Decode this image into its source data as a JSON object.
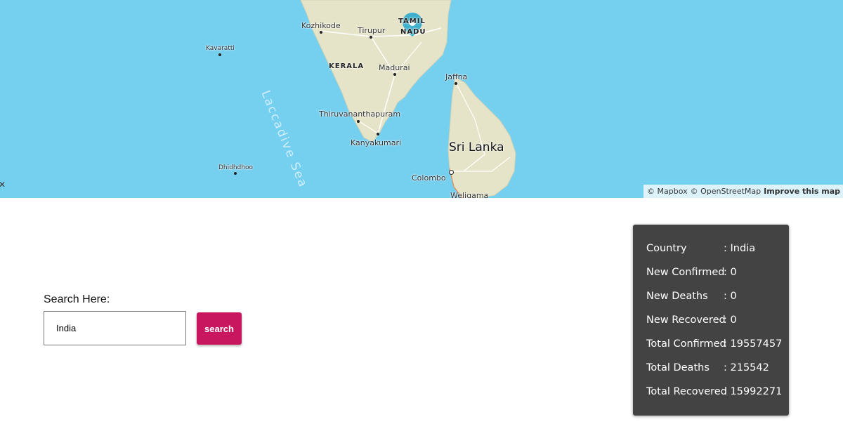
{
  "map": {
    "labels": {
      "kozhikode": "Kozhikode",
      "tirupur": "Tirupur",
      "kavaratti": "Kavaratti",
      "kerala": "KERALA",
      "madurai": "Madurai",
      "jaffna": "Jaffna",
      "thiruvananthapuram": "Thiruvananthapuram",
      "kanyakumari": "Kanyakumari",
      "sri_lanka": "Sri Lanka",
      "dhidhdhoo": "Dhidhdhoo",
      "colombo": "Colombo",
      "weligama": "Weligama",
      "tamil_nadu_1": "TAMIL",
      "tamil_nadu_2": "NADU",
      "laccadive_sea": "Laccadive Sea"
    },
    "attribution": {
      "mapbox": "© Mapbox",
      "osm": "© OpenStreetMap",
      "improve": "Improve this map"
    },
    "colors": {
      "water": "#75cfef",
      "land": "#e6e4c8",
      "marker": "#3fb1ce"
    }
  },
  "search": {
    "label": "Search Here:",
    "value": "India",
    "button_label": "search",
    "button_color": "#c8175f"
  },
  "stats": {
    "background": "#434343",
    "rows": [
      {
        "key": "Country",
        "value": ": India"
      },
      {
        "key": "New Confirmed",
        "value": ": 0"
      },
      {
        "key": "New Deaths",
        "value": ": 0"
      },
      {
        "key": "New Recovered",
        "value": ": 0"
      },
      {
        "key": "Total Confirmed",
        "value": ": 19557457"
      },
      {
        "key": "Total Deaths",
        "value": ": 215542"
      },
      {
        "key": "Total Recovered",
        "value": ": 15992271"
      }
    ]
  }
}
